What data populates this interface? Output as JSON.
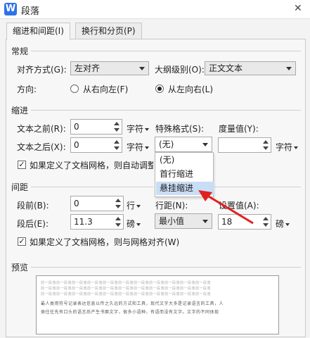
{
  "window": {
    "title": "段落",
    "app_icon": "W"
  },
  "tabs": [
    {
      "label": "缩进和间距(I)"
    },
    {
      "label": "换行和分页(P)"
    }
  ],
  "general": {
    "section": "常规",
    "align_label": "对齐方式(G):",
    "align_value": "左对齐",
    "outline_label": "大纲级别(O):",
    "outline_value": "正文文本",
    "direction_label": "方向:",
    "rtl_label": "从右向左(F)",
    "ltr_label": "从左向右(L)"
  },
  "indent": {
    "section": "缩进",
    "before_label": "文本之前(R):",
    "before_value": "0",
    "before_unit": "字符",
    "after_label": "文本之后(X):",
    "after_value": "0",
    "after_unit": "字符",
    "special_label": "特殊格式(S):",
    "special_value": "(无)",
    "measure_label": "度量值(Y):",
    "measure_value": "",
    "measure_unit": "字符",
    "grid_check": "如果定义了文档网格，则自动调整"
  },
  "dropdown": {
    "options": [
      "(无)",
      "首行缩进",
      "悬挂缩进"
    ]
  },
  "spacing": {
    "section": "间距",
    "before_label": "段前(B):",
    "before_value": "0",
    "before_unit": "行",
    "after_label": "段后(E):",
    "after_value": "11.3",
    "after_unit": "磅",
    "line_label": "行距(N):",
    "line_value": "最小值",
    "at_label": "设置值(A):",
    "at_value": "18",
    "at_unit": "磅",
    "grid_check": "如果定义了文档网格，则与网格对齐(W)"
  },
  "preview": {
    "section": "预览",
    "gray_line": "前一段落前一段落前一段落前一段落前一段落前一段落前一段落前一段落前一段落前一段落前一段落",
    "text_line1": "最人类用符号记录表达信息以传之久远的方式和工具，现代文字大多是记录语言的工具，人",
    "text_line2": "类往往先有口头的语言后产生书面文字，很多小语种，有语而没有文字。文字的不同体现"
  },
  "colors": {
    "accent": "#2f73e8",
    "highlight": "#c9ddf5",
    "arrow": "#e02020"
  }
}
